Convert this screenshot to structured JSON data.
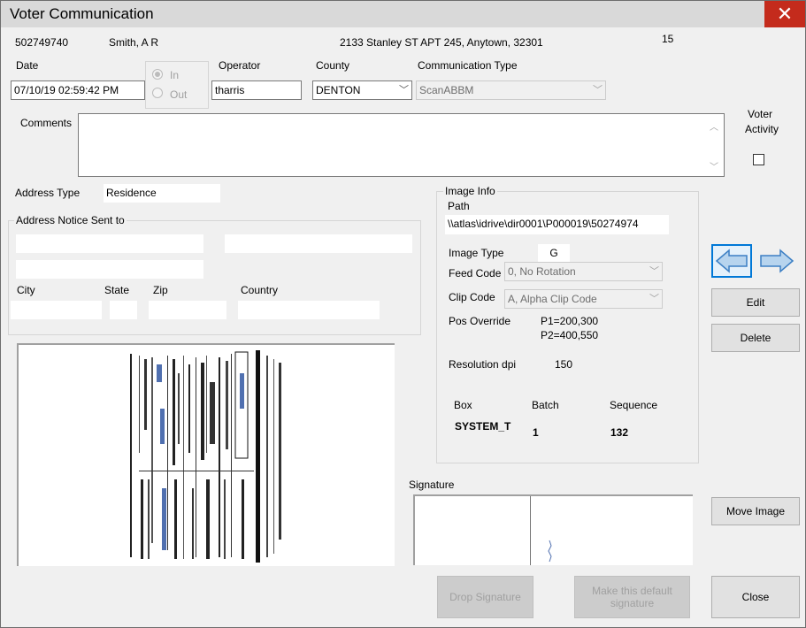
{
  "window": {
    "title": "Voter Communication",
    "close_glyph": "✕"
  },
  "header": {
    "voter_id": "502749740",
    "name": "Smith, A R",
    "address": "2133 Stanley ST APT 245, Anytown, 32301",
    "count": "15"
  },
  "form": {
    "date_label": "Date",
    "date_value": "07/10/19 02:59:42 PM",
    "direction": {
      "in_label": "In",
      "out_label": "Out",
      "selected": "In"
    },
    "operator_label": "Operator",
    "operator_value": "tharris",
    "county_label": "County",
    "county_value": "DENTON",
    "comm_type_label": "Communication Type",
    "comm_type_value": "ScanABBM",
    "comments_label": "Comments",
    "comments_value": "",
    "voter_activity_label_1": "Voter",
    "voter_activity_label_2": "Activity"
  },
  "address": {
    "type_label": "Address Type",
    "type_value": "Residence",
    "notice_group_label": "Address Notice Sent to",
    "city_label": "City",
    "state_label": "State",
    "zip_label": "Zip",
    "country_label": "Country"
  },
  "image_info": {
    "group_label": "Image Info",
    "path_label": "Path",
    "path_value": "\\\\atlas\\idrive\\dir0001\\P000019\\50274974",
    "image_type_label": "Image Type",
    "image_type_value": "G",
    "feed_code_label": "Feed Code",
    "feed_code_value": "0, No Rotation",
    "clip_code_label": "Clip Code",
    "clip_code_value": "A, Alpha Clip Code",
    "pos_override_label": "Pos Override",
    "pos_p1": "P1=200,300",
    "pos_p2": "P2=400,550",
    "resolution_label": "Resolution dpi",
    "resolution_value": "150",
    "box_label": "Box",
    "box_value": "SYSTEM_T",
    "batch_label": "Batch",
    "batch_value": "1",
    "sequence_label": "Sequence",
    "sequence_value": "132"
  },
  "signature": {
    "label": "Signature"
  },
  "buttons": {
    "edit": "Edit",
    "delete": "Delete",
    "move_image": "Move Image",
    "drop_signature": "Drop Signature",
    "make_default_1": "Make this default",
    "make_default_2": "signature",
    "close": "Close"
  },
  "icons": {
    "prev": "arrow-left-icon",
    "next": "arrow-right-icon"
  }
}
